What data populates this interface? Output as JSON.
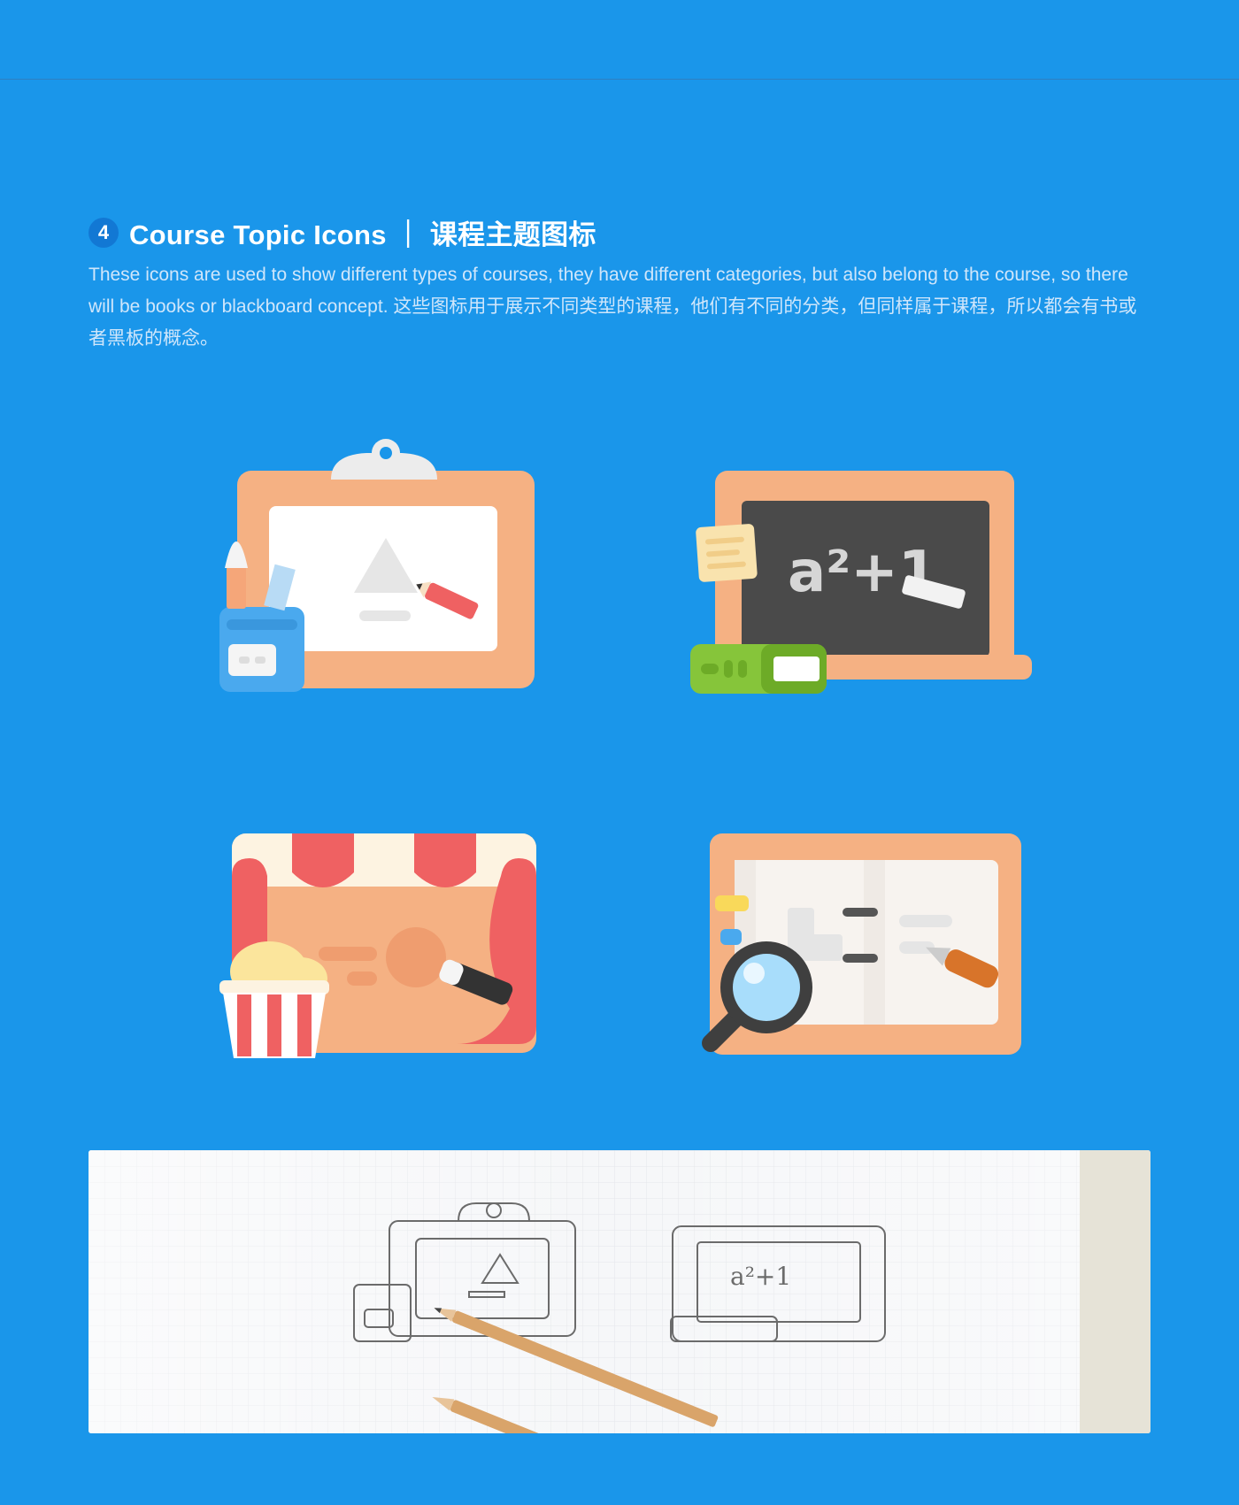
{
  "section": {
    "number": "4",
    "title": "Course Topic Icons ｜ 课程主题图标",
    "description": "These icons are used to show different types of courses, they have different categories, but also belong to the course, so there will be books or blackboard concept. 这些图标用于展示不同类型的课程，他们有不同的分类，但同样属于课程，所以都会有书或者黑板的概念。"
  },
  "icons": [
    {
      "name": "art-clipboard-icon"
    },
    {
      "name": "math-blackboard-icon",
      "formula": "a²+1"
    },
    {
      "name": "theater-stage-icon"
    },
    {
      "name": "notebook-search-icon"
    }
  ],
  "sketch": {
    "name": "pencil-sketch-photo"
  },
  "colors": {
    "background": "#1a96ea",
    "frame": "#f5b183",
    "blackboard": "#4a4a4a",
    "curtain": "#ef6162",
    "book_green": "#86c53a"
  }
}
